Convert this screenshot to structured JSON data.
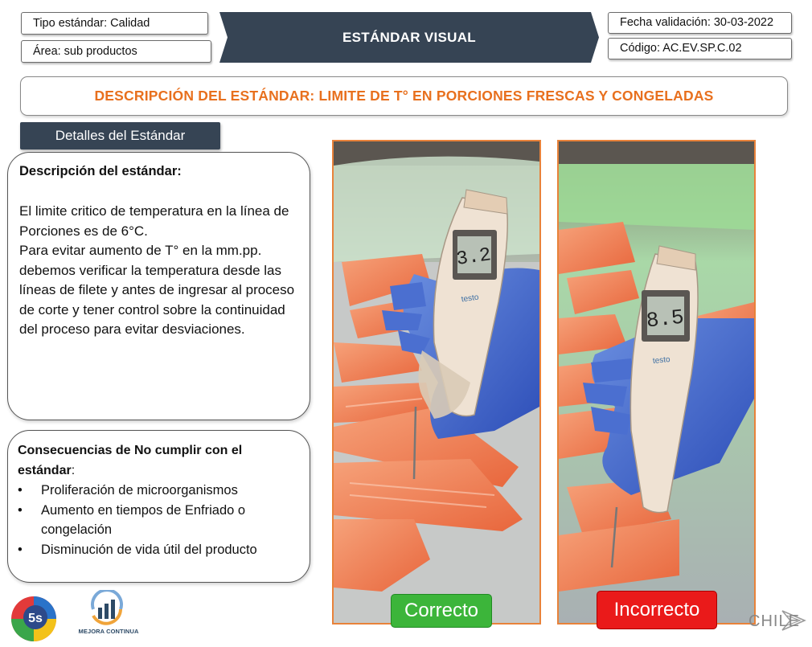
{
  "header": {
    "tipo": "Tipo estándar: Calidad",
    "area": "Área: sub productos",
    "banner": "ESTÁNDAR VISUAL",
    "fecha": "Fecha validación: 30-03-2022",
    "codigo": "Código: AC.EV.SP.C.02"
  },
  "title": "DESCRIPCIÓN DEL ESTÁNDAR: LIMITE DE T° EN PORCIONES FRESCAS Y CONGELADAS",
  "detalles_tab": "Detalles del Estándar",
  "descripcion": {
    "heading": "Descripción del estándar:",
    "body": "El limite critico de temperatura en la línea de Porciones es de 6°C.\nPara evitar aumento de T° en la mm.pp. debemos verificar la temperatura desde las líneas de filete y antes de ingresar al proceso de corte y tener control sobre la continuidad del proceso para evitar desviaciones."
  },
  "consecuencias": {
    "heading": "Consecuencias de No cumplir con el estándar",
    "colon": ":",
    "items": [
      "Proliferación de microorganismos",
      "Aumento en tiempos de Enfriado o congelación",
      "Disminución de vida útil del producto"
    ]
  },
  "photos": {
    "correct_reading": "3.2",
    "incorrect_reading": "8.5",
    "device_brand": "testo",
    "correct_label": "Correcto",
    "incorrect_label": "Incorrecto"
  },
  "logos": {
    "five_s": "5s",
    "mejora": "MEJORA CONTINUA",
    "chile": "CHILE"
  },
  "colors": {
    "banner": "#364454",
    "accent_orange": "#e8701e",
    "correct_green": "#3cb53a",
    "incorrect_red": "#ea1a1a"
  }
}
